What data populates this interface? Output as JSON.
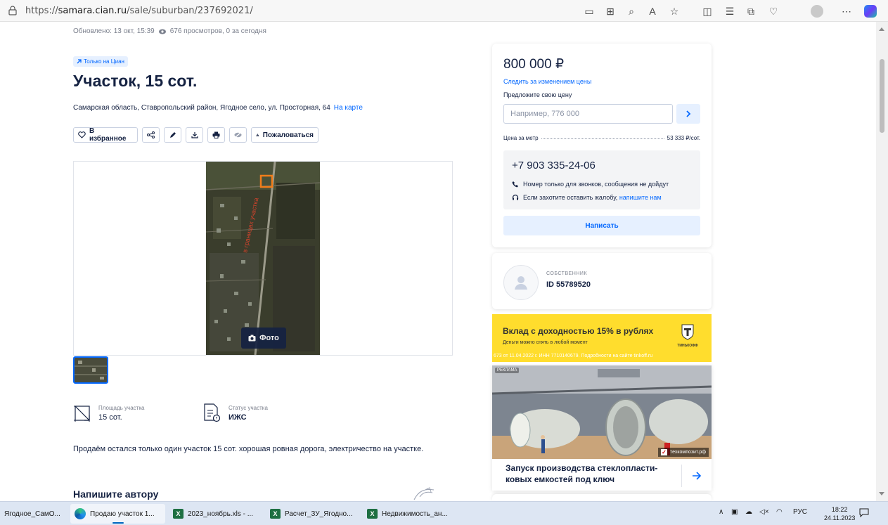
{
  "browser": {
    "url_prefix": "https://",
    "url_domain": "samara.cian.ru",
    "url_path": "/sale/suburban/237692021/",
    "zoom_ellipsis": "⋯"
  },
  "meta": {
    "updated": "Обновлено: 13 окт, 15:39",
    "views": "676 просмотров, 0 за сегодня"
  },
  "listing": {
    "badge": "Только на Циан",
    "title": "Участок, 15 сот.",
    "address": "Самарская область, Ставропольский район, Ягодное село, ул. Просторная, 64",
    "map_link": "На карте",
    "photo_button": "Фото",
    "description": "Продаём остался только один участок 15 сот. хорошая ровная дорога, электричество на участке.",
    "write_author": "Напишите автору"
  },
  "actions": {
    "favorite": "В избранное",
    "complain": "Пожаловаться"
  },
  "features": [
    {
      "label": "Площадь участка",
      "value": "15 сот."
    },
    {
      "label": "Статус участка",
      "value": "ИЖС"
    }
  ],
  "price_card": {
    "price": "800 000 ₽",
    "follow": "Следить за изменением цены",
    "offer_label": "Предложите свою цену",
    "offer_placeholder": "Например, 776 000",
    "per_meter_label": "Цена за метр",
    "per_meter_value": "53 333 ₽/сот.",
    "phone": "+7 903 335-24-06",
    "phone_note": "Номер только для звонков, сообщения не дойдут",
    "complaint_note": "Если захотите оставить жалобу,",
    "complaint_link": "напишите нам",
    "write_button": "Написать"
  },
  "owner": {
    "role": "СОБСТВЕННИК",
    "id": "ID 55789520"
  },
  "ad_tinkoff": {
    "headline": "Вклад с доходностью 15% в рублях",
    "sub": "Деньги можно снять в любой момент",
    "logo_text": "ТИНЬКОФФ",
    "legal": "673 от 11.04.2022 г. ИНН 7710140679. Подробности на сайте tinkoff.ru"
  },
  "ad_factory": {
    "label": "РЕКЛАМА",
    "brand": "техкомпозит.рф",
    "text": "Запуск производства стеклопласти-ковых емкостей под ключ"
  },
  "taskbar": {
    "items": [
      {
        "label": "Ягодное_СамО..."
      },
      {
        "label": "Продаю участок 1..."
      },
      {
        "label": "2023_ноябрь.xls - ..."
      },
      {
        "label": "Расчет_ЗУ_Ягодно..."
      },
      {
        "label": "Недвижимость_ан..."
      }
    ],
    "lang": "РУС",
    "time": "18:22",
    "date": "24.11.2023"
  },
  "colors": {
    "accent": "#0468ff",
    "text": "#152242",
    "ad_yellow": "#ffdd2d"
  }
}
